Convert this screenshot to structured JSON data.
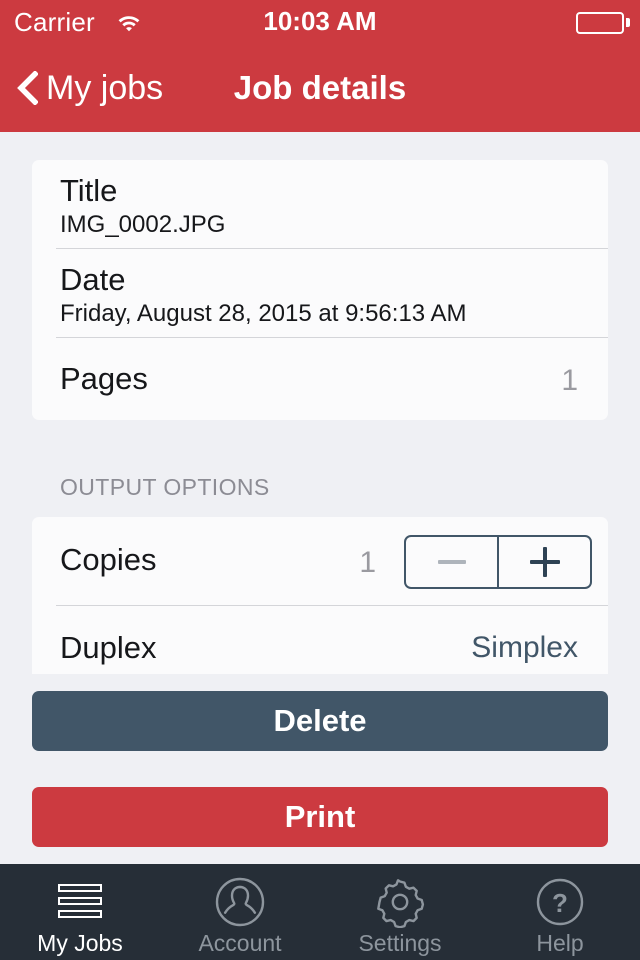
{
  "status_bar": {
    "carrier": "Carrier",
    "time": "10:03 AM",
    "wifi_icon": "wifi-icon",
    "battery_icon": "battery-icon"
  },
  "nav_bar": {
    "back_label": "My jobs",
    "back_icon": "chevron-left-icon",
    "title": "Job details",
    "background_color": "#cc3a40"
  },
  "details": {
    "rows": [
      {
        "label": "Title",
        "value": "IMG_0002.JPG"
      },
      {
        "label": "Date",
        "value": "Friday, August 28, 2015 at 9:56:13 AM"
      },
      {
        "label": "Pages",
        "value": "1"
      }
    ]
  },
  "output_options": {
    "section_header": "OUTPUT OPTIONS",
    "copies": {
      "label": "Copies",
      "value": "1",
      "decrement_icon": "minus-icon",
      "increment_icon": "plus-icon",
      "decrement_enabled": false,
      "increment_enabled": true
    },
    "duplex": {
      "label": "Duplex",
      "value": "Simplex"
    }
  },
  "actions": {
    "delete_label": "Delete",
    "delete_color": "#415668",
    "print_label": "Print",
    "print_color": "#cc3a40"
  },
  "tab_bar": {
    "active_index": 0,
    "items": [
      {
        "label": "My Jobs",
        "icon": "list-lines-icon"
      },
      {
        "label": "Account",
        "icon": "person-circle-icon"
      },
      {
        "label": "Settings",
        "icon": "gear-icon"
      },
      {
        "label": "Help",
        "icon": "question-circle-icon"
      }
    ]
  }
}
